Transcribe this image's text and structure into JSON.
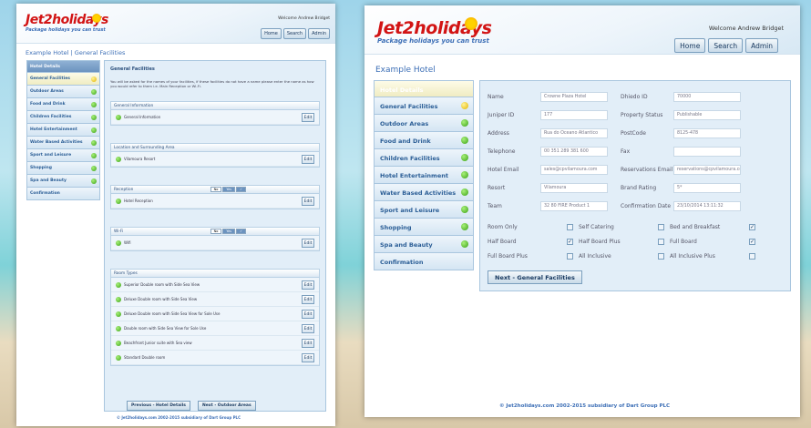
{
  "brand": {
    "name": "Jet2holidays",
    "tagline": "Package holidays you can trust"
  },
  "header": {
    "welcome": "Welcome Andrew Bridget",
    "nav": [
      "Home",
      "Search",
      "Admin"
    ]
  },
  "sidebar": {
    "items": [
      {
        "label": "Hotel Details",
        "dot": "none"
      },
      {
        "label": "General Facilities",
        "dot": "yellow"
      },
      {
        "label": "Outdoor Areas",
        "dot": "green"
      },
      {
        "label": "Food and Drink",
        "dot": "green"
      },
      {
        "label": "Children Facilities",
        "dot": "green"
      },
      {
        "label": "Hotel Entertainment",
        "dot": "green"
      },
      {
        "label": "Water Based Activities",
        "dot": "green"
      },
      {
        "label": "Sport and Leisure",
        "dot": "green"
      },
      {
        "label": "Shopping",
        "dot": "green"
      },
      {
        "label": "Spa and Beauty",
        "dot": "green"
      },
      {
        "label": "Confirmation",
        "dot": "none"
      }
    ]
  },
  "left": {
    "page_title": "Example Hotel | General Facilities",
    "section_title": "General Facilities",
    "intro": "You will be asked for the names of your facilities, if these facilities do not have a name please enter the name as how you would refer to them i.e. Main Reception or Wi-Fi.",
    "edit_label": "Edit",
    "toggle": {
      "no": "No",
      "yes": "Yes",
      "check": "✓"
    },
    "groups": [
      {
        "title": "General Information",
        "rows": [
          "General Information"
        ]
      },
      {
        "title": "Location and Surrounding Area",
        "rows": [
          "Vilamoura Resort"
        ]
      },
      {
        "title": "Reception",
        "toggle": true,
        "rows": [
          "Hotel Reception"
        ]
      },
      {
        "title": "Wi-Fi",
        "toggle": true,
        "rows": [
          "Wifi"
        ]
      },
      {
        "title": "Room Types",
        "rows": [
          "Superior Double room with Side Sea View",
          "Deluxe Double room with Side Sea View",
          "Deluxe Double room with Side Sea View for Sole Use",
          "Double room with Side Sea View for Sole Use",
          "Beachfront Junior suite with Sea view",
          "Standard Double room"
        ]
      }
    ],
    "prev_button": "Previous - Hotel Details",
    "next_button": "Next - Outdoor Areas",
    "footer": "© Jet2holidays.com 2002-2015 subsidiary of Dart Group PLC"
  },
  "right": {
    "page_title": "Example Hotel",
    "fields": [
      {
        "l1": "Name",
        "v1": "Crowne Plaza Hotel",
        "l2": "Dhiedo ID",
        "v2": "70000"
      },
      {
        "l1": "Juniper ID",
        "v1": "177",
        "l2": "Property Status",
        "v2": "Publishable"
      },
      {
        "l1": "Address",
        "v1": "Rua do Oceano Atlantico",
        "l2": "PostCode",
        "v2": "8125-478"
      },
      {
        "l1": "Telephone",
        "v1": "00 351 289 381 600",
        "l2": "Fax",
        "v2": ""
      },
      {
        "l1": "Hotel Email",
        "v1": "sales@cpvilamoura.com",
        "l2": "Reservations Email",
        "v2": "reservations@cpvilamoura.com"
      },
      {
        "l1": "Resort",
        "v1": "Vilamoura",
        "l2": "Brand Rating",
        "v2": "5*"
      },
      {
        "l1": "Team",
        "v1": "32 80 FIRE Product 1",
        "l2": "Confirmation Date",
        "v2": "23/10/2014 13:11:32"
      }
    ],
    "boards": [
      [
        {
          "label": "Room Only",
          "checked": false
        },
        {
          "label": "Self Catering",
          "checked": false
        },
        {
          "label": "Bed and Breakfast",
          "checked": true
        }
      ],
      [
        {
          "label": "Half Board",
          "checked": true
        },
        {
          "label": "Half Board Plus",
          "checked": false
        },
        {
          "label": "Full Board",
          "checked": true
        }
      ],
      [
        {
          "label": "Full Board Plus",
          "checked": false
        },
        {
          "label": "All Inclusive",
          "checked": false
        },
        {
          "label": "All Inclusive Plus",
          "checked": false
        }
      ]
    ],
    "next_button": "Next - General Facilities",
    "footer": "© Jet2holidays.com 2002-2015 subsidiary of Dart Group PLC"
  }
}
